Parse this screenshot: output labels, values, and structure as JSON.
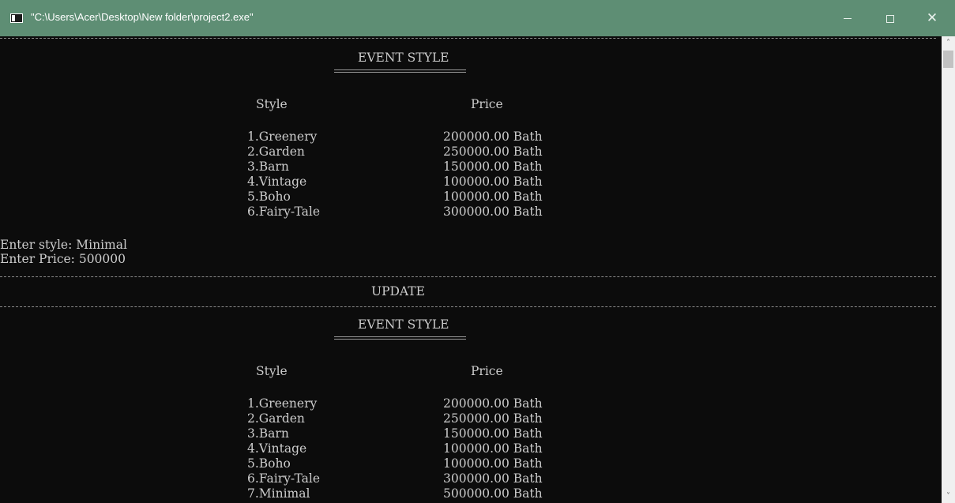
{
  "window": {
    "title": "\"C:\\Users\\Acer\\Desktop\\New folder\\project2.exe\"",
    "buttons": {
      "minimize": "–",
      "maximize": "□",
      "close": "✕"
    }
  },
  "console": {
    "block1": {
      "heading": "EVENT STYLE",
      "col_style": "Style",
      "col_price": "Price",
      "rows": [
        {
          "style": "1.Greenery",
          "price": "200000.00 Bath"
        },
        {
          "style": "2.Garden",
          "price": "250000.00 Bath"
        },
        {
          "style": "3.Barn",
          "price": "150000.00 Bath"
        },
        {
          "style": "4.Vintage",
          "price": "100000.00 Bath"
        },
        {
          "style": "5.Boho",
          "price": "100000.00 Bath"
        },
        {
          "style": "6.Fairy-Tale",
          "price": "300000.00 Bath"
        }
      ]
    },
    "prompts": [
      "Enter style: Minimal",
      "Enter Price: 500000"
    ],
    "update_label": "UPDATE",
    "block2": {
      "heading": "EVENT STYLE",
      "col_style": "Style",
      "col_price": "Price",
      "rows": [
        {
          "style": "1.Greenery",
          "price": "200000.00 Bath"
        },
        {
          "style": "2.Garden",
          "price": "250000.00 Bath"
        },
        {
          "style": "3.Barn",
          "price": "150000.00 Bath"
        },
        {
          "style": "4.Vintage",
          "price": "100000.00 Bath"
        },
        {
          "style": "5.Boho",
          "price": "100000.00 Bath"
        },
        {
          "style": "6.Fairy-Tale",
          "price": "300000.00 Bath"
        },
        {
          "style": "7.Minimal",
          "price": "500000.00 Bath"
        }
      ]
    }
  },
  "scrollbar": {
    "up": "˄",
    "down": "˅"
  }
}
